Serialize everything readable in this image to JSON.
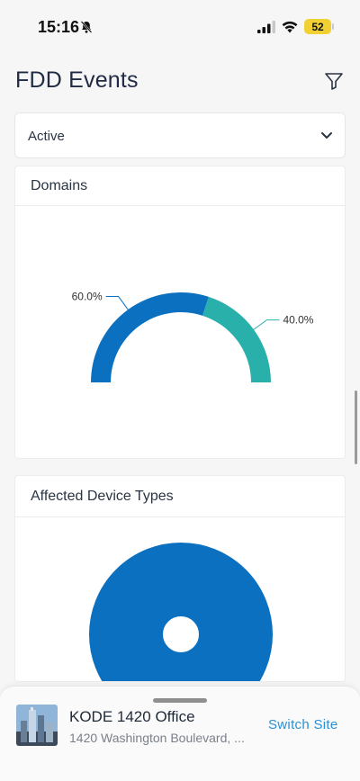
{
  "status_bar": {
    "time": "15:16",
    "battery": "52"
  },
  "header": {
    "title": "FDD Events"
  },
  "status_filter": {
    "value": "Active"
  },
  "domains_card": {
    "title": "Domains"
  },
  "devices_card": {
    "title": "Affected Device Types"
  },
  "chart_data": [
    {
      "type": "pie",
      "variant": "semi-donut",
      "title": "Domains",
      "slices": [
        {
          "label": "60.0%",
          "value": 60.0,
          "color": "#0a70bf"
        },
        {
          "label": "40.0%",
          "value": 40.0,
          "color": "#2ab0ab"
        }
      ]
    },
    {
      "type": "pie",
      "variant": "donut",
      "title": "Affected Device Types",
      "slices": [
        {
          "value": 100,
          "color": "#0a70bf"
        }
      ]
    }
  ],
  "bottom_sheet": {
    "site_name": "KODE 1420 Office",
    "site_address": "1420 Washington Boulevard, ...",
    "switch_label": "Switch Site"
  },
  "icons": {
    "bell": "bell-slash-icon",
    "filter": "filter-icon",
    "chevron": "chevron-down-icon"
  }
}
